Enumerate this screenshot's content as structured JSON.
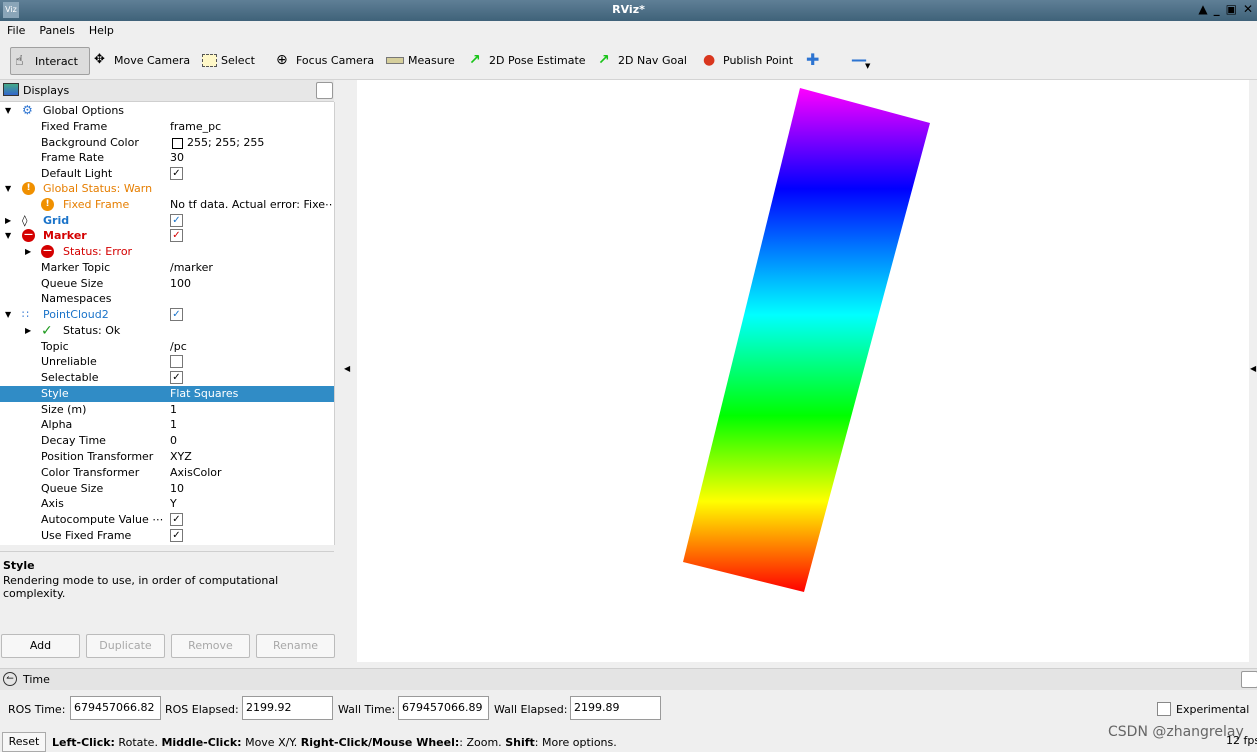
{
  "window": {
    "title": "RViz*",
    "app_icon": "Viz"
  },
  "menu": {
    "items": [
      "File",
      "Panels",
      "Help"
    ]
  },
  "toolbar": {
    "interact": "Interact",
    "move_camera": "Move Camera",
    "select": "Select",
    "focus_camera": "Focus Camera",
    "measure": "Measure",
    "pose_estimate": "2D Pose Estimate",
    "nav_goal": "2D Nav Goal",
    "publish_point": "Publish Point"
  },
  "displays": {
    "title": "Displays",
    "rows": {
      "global_options": "Global Options",
      "fixed_frame_label": "Fixed Frame",
      "fixed_frame_value": "frame_pc",
      "bg_color_label": "Background Color",
      "bg_color_value": "255; 255; 255",
      "frame_rate_label": "Frame Rate",
      "frame_rate_value": "30",
      "default_light_label": "Default Light",
      "global_status": "Global Status: Warn",
      "gs_fixed_frame": "Fixed Frame",
      "gs_fixed_frame_value": "No tf data.  Actual error: Fixe⋯",
      "grid": "Grid",
      "marker": "Marker",
      "marker_status": "Status: Error",
      "marker_topic_label": "Marker Topic",
      "marker_topic_value": "/marker",
      "queue_size_label": "Queue Size",
      "queue_size_value": "100",
      "namespaces_label": "Namespaces",
      "pointcloud": "PointCloud2",
      "pc_status": "Status: Ok",
      "topic_label": "Topic",
      "topic_value": "/pc",
      "unreliable_label": "Unreliable",
      "selectable_label": "Selectable",
      "style_label": "Style",
      "style_value": "Flat Squares",
      "size_label": "Size (m)",
      "size_value": "1",
      "alpha_label": "Alpha",
      "alpha_value": "1",
      "decay_label": "Decay Time",
      "decay_value": "0",
      "pos_tf_label": "Position Transformer",
      "pos_tf_value": "XYZ",
      "color_tf_label": "Color Transformer",
      "color_tf_value": "AxisColor",
      "pc_queue_label": "Queue Size",
      "pc_queue_value": "10",
      "axis_label": "Axis",
      "axis_value": "Y",
      "autocompute_label": "Autocompute Value ⋯",
      "use_fixed_label": "Use Fixed Frame"
    },
    "description": {
      "title": "Style",
      "text": "Rendering mode to use, in order of computational complexity."
    },
    "buttons": {
      "add": "Add",
      "duplicate": "Duplicate",
      "remove": "Remove",
      "rename": "Rename"
    }
  },
  "time": {
    "title": "Time",
    "ros_time_label": "ROS Time:",
    "ros_time_value": "679457066.82",
    "ros_elapsed_label": "ROS Elapsed:",
    "ros_elapsed_value": "2199.92",
    "wall_time_label": "Wall Time:",
    "wall_time_value": "679457066.89",
    "wall_elapsed_label": "Wall Elapsed:",
    "wall_elapsed_value": "2199.89",
    "experimental_label": "Experimental"
  },
  "status": {
    "reset": "Reset",
    "left_click": "Left-Click:",
    "left_click_text": " Rotate. ",
    "middle_click": "Middle-Click:",
    "middle_click_text": " Move X/Y. ",
    "right_click": "Right-Click/Mouse Wheel:",
    "right_click_text": ": Zoom. ",
    "shift": "Shift",
    "shift_text": ": More options.",
    "fps": "12 fps",
    "watermark": "CSDN @zhangrelay"
  },
  "colors": {
    "selection": "#308cc6",
    "warn": "#e67e00",
    "error": "#d40000",
    "link_blue": "#1a73c9",
    "gradient": [
      "#ff00ff",
      "#0000ff",
      "#00ffff",
      "#00ff00",
      "#ffff00",
      "#ff0000"
    ]
  }
}
